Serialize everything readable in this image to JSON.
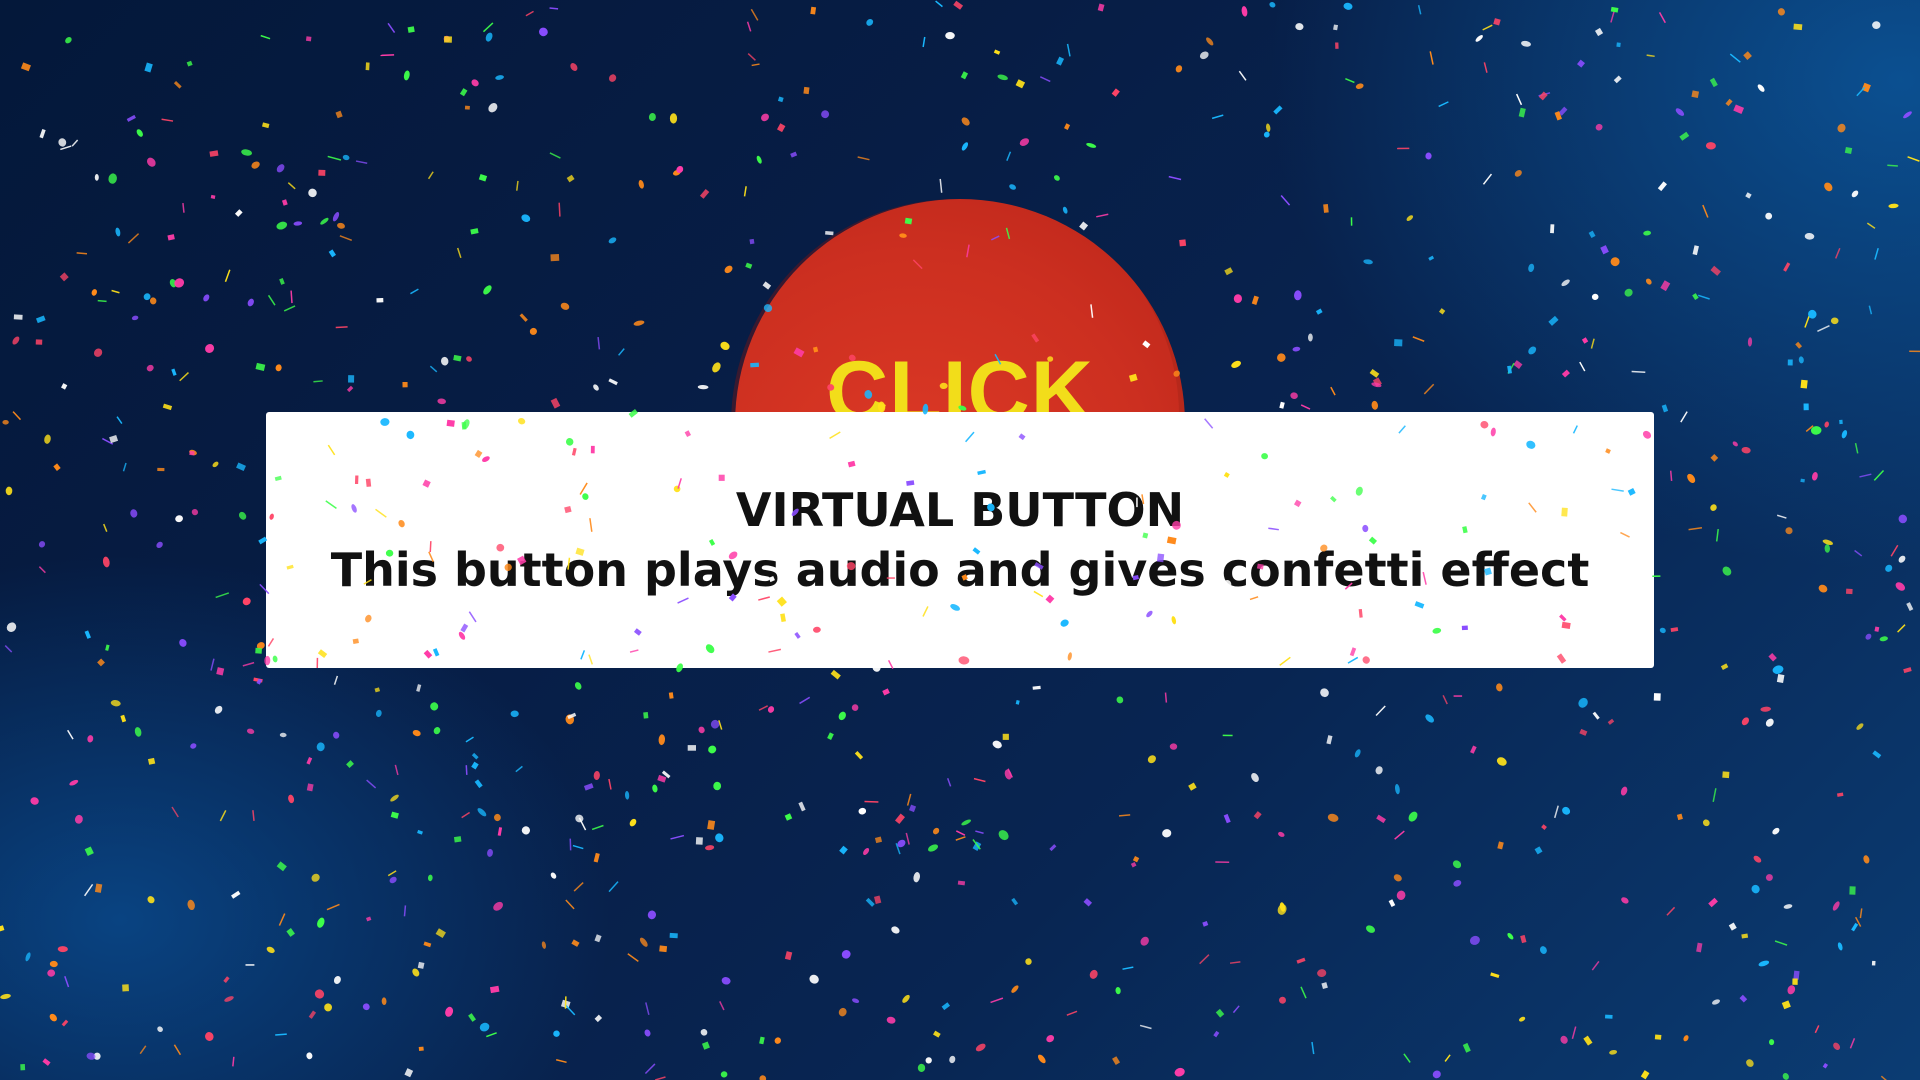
{
  "button": {
    "label": "CLICK",
    "color": "#cc2f20",
    "label_color": "#f2dd1a"
  },
  "panel": {
    "title": "VIRTUAL BUTTON",
    "subtitle": "This button plays audio and gives confetti effect"
  },
  "background": {
    "color_dark": "#04183a",
    "color_light": "#0b3c73"
  },
  "confetti": {
    "colors": [
      "#ff3ca8",
      "#8a4dff",
      "#19b8ff",
      "#ffe11a",
      "#ff8a1a",
      "#3dff4a",
      "#ff4466",
      "#ffffff"
    ]
  }
}
